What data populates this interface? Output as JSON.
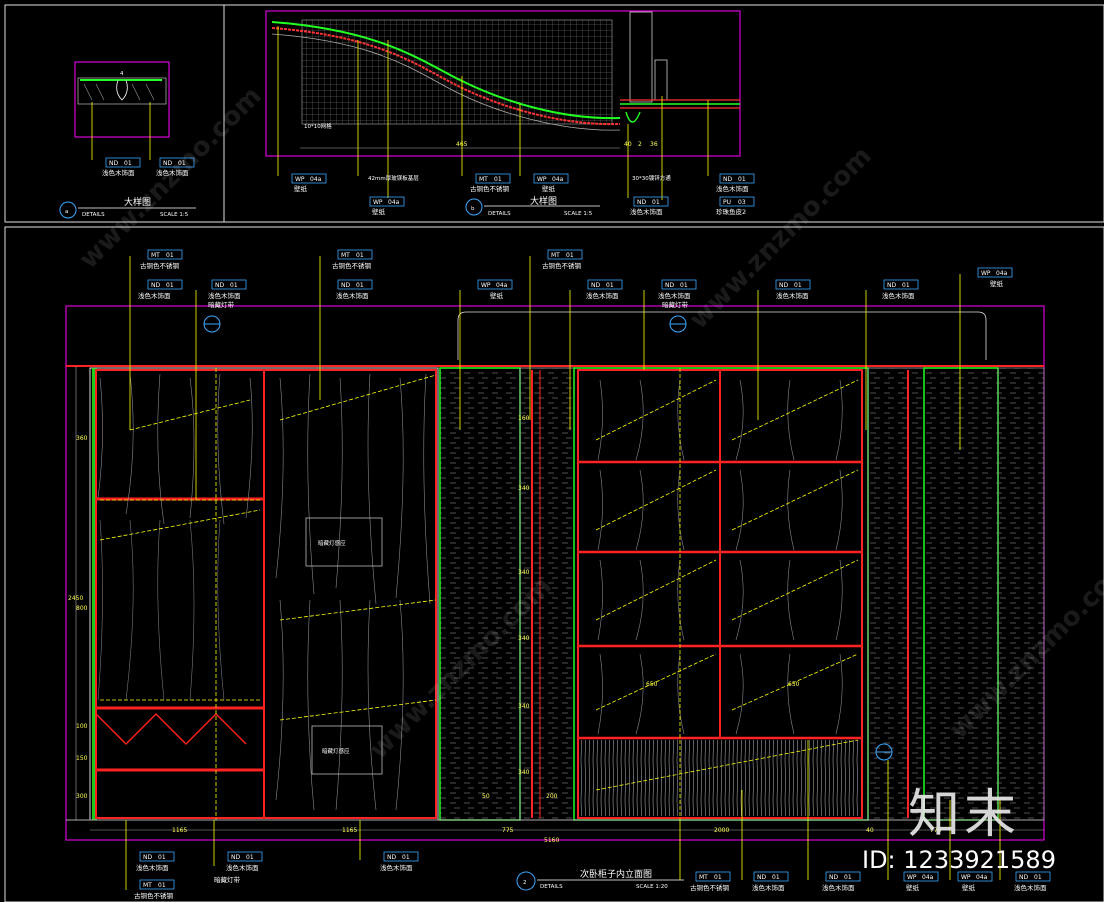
{
  "materials": {
    "nd": "ND",
    "nd_num": "01",
    "nd_name": "浅色木饰面",
    "mt": "MT",
    "mt_num": "01",
    "mt_name": "古铜色不锈钢",
    "wp": "WP",
    "wp_num": "04a",
    "wp_name": "壁纸",
    "pu": "PU",
    "pu_num": "03",
    "pu_name": "珍珠鱼皮2",
    "hidden_light": "暗藏灯带",
    "steel": "30*30镀锌方通",
    "board": "42mm厚玻镁板基层",
    "grid": "10*10网格"
  },
  "detail_a": {
    "badge": "a",
    "title": "大样图",
    "sub": "DETAILS",
    "scale": "SCALE 1:5",
    "mark": "4"
  },
  "detail_b": {
    "badge": "b",
    "title": "大样图",
    "sub": "DETAILS",
    "scale": "SCALE 1:5",
    "dims": [
      "465",
      "40",
      "2",
      "36"
    ]
  },
  "elevation": {
    "badge": "2",
    "title": "次卧柜子内立面图",
    "sub": "DETAILS",
    "scale": "SCALE 1:20",
    "dims_bottom": [
      "1165",
      "1165",
      "775",
      "2000",
      "40",
      "775"
    ],
    "total": "5160",
    "left_height": "2450",
    "left_dims": [
      "360",
      "800",
      "100",
      "150",
      "300"
    ],
    "col_dims": [
      "160",
      "340",
      "340",
      "340",
      "340",
      "340",
      "50",
      "200"
    ],
    "shelf_dims": [
      "650",
      "650"
    ],
    "panel_text": "暗藏灯感应"
  },
  "watermark": "www.znzmo.com",
  "brand": "知末",
  "id_text": "ID: 1233921589"
}
